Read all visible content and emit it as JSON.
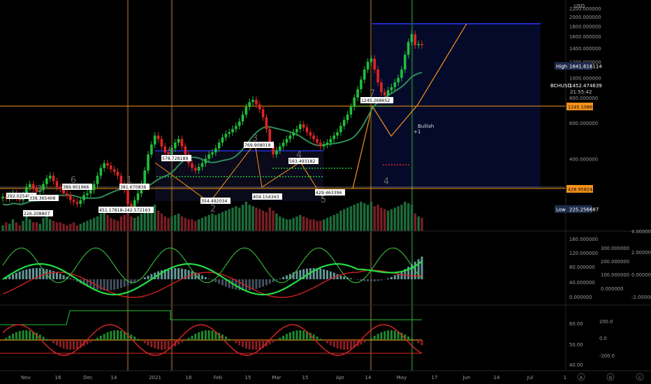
{
  "currency": "USD",
  "symbol_tag": "BCHUSD",
  "last_price": "1452.474639",
  "countdown": "21:55:42",
  "high": {
    "label": "High",
    "value": "1641.616114"
  },
  "low": {
    "label": "Low",
    "value": "225.256687"
  },
  "right_badges": [
    "1245.108652",
    "428.958243"
  ],
  "bullish_label": "Bullish",
  "bullish_count": "+1",
  "wave_labels": [
    "3",
    "6",
    "9",
    "1",
    "2",
    "3",
    "4",
    "5",
    "7",
    "4"
  ],
  "price_pivots": [
    "292.025496",
    "338.365408",
    "389.901966",
    "381.670836",
    "226.208807",
    "451.178184",
    "242.572163",
    "578.728189",
    "354.492034",
    "769.908019",
    "404.154343",
    "593.493182",
    "429.463396",
    "1245.268652"
  ],
  "scales": {
    "main": [
      "2200.000000",
      "2000.000000",
      "1800.000000",
      "1600.000000",
      "1400.000000",
      "1200.000000",
      "1000.000000",
      "800.000000",
      "600.000000",
      "400.000000"
    ],
    "macd_left": [
      "160.000000",
      "120.000000",
      "80.000000",
      "40.000000",
      "0.000000"
    ],
    "macd_mid": [
      "300.000000",
      "200.000000",
      "100.000000",
      "0.000000",
      "-100.000000"
    ],
    "macd_right": [
      "4.000000",
      "2.000000",
      "0.000000",
      "-2.000000"
    ],
    "osc_left": [
      "60.00",
      "50.00",
      "40.00"
    ],
    "osc_right": [
      "200.0",
      "0.0",
      "-200.0"
    ]
  },
  "x_axis": [
    "Nov",
    "16",
    "Dec",
    "14",
    "2021",
    "18",
    "Feb",
    "15",
    "Mar",
    "15",
    "Apr",
    "14",
    "May",
    "17",
    "Jun",
    "14",
    "Jul",
    "1"
  ],
  "corner_buttons": [
    "A",
    "B",
    "C"
  ],
  "chart_data": {
    "type": "candlestick",
    "symbol": "BCHUSD",
    "ylim": [
      225,
      2200
    ],
    "x_range": [
      "Oct 2020",
      "Jul 2021"
    ],
    "closes": [
      260,
      255,
      262,
      270,
      258,
      250,
      265,
      290,
      300,
      285,
      275,
      280,
      300,
      320,
      330,
      310,
      290,
      285,
      270,
      265,
      250,
      245,
      240,
      250,
      265,
      270,
      280,
      300,
      330,
      360,
      380,
      370,
      355,
      345,
      330,
      300,
      280,
      240,
      230,
      250,
      270,
      300,
      350,
      420,
      470,
      520,
      500,
      460,
      430,
      420,
      450,
      480,
      500,
      460,
      420,
      380,
      360,
      350,
      365,
      380,
      400,
      420,
      430,
      450,
      480,
      510,
      530,
      540,
      560,
      580,
      610,
      660,
      720,
      760,
      780,
      740,
      700,
      640,
      560,
      470,
      420,
      440,
      460,
      480,
      500,
      520,
      540,
      560,
      590,
      570,
      540,
      520,
      500,
      480,
      460,
      470,
      480,
      500,
      520,
      540,
      580,
      620,
      660,
      720,
      800,
      880,
      980,
      1100,
      1200,
      1245,
      1100,
      950,
      850,
      820,
      870,
      900,
      950,
      1000,
      1100,
      1300,
      1500,
      1640,
      1450,
      1470,
      1452
    ],
    "volumes": [
      0.2,
      0.3,
      0.25,
      0.4,
      0.3,
      0.2,
      0.35,
      0.5,
      0.4,
      0.3,
      0.3,
      0.25,
      0.45,
      0.5,
      0.4,
      0.35,
      0.3,
      0.3,
      0.25,
      0.2,
      0.25,
      0.3,
      0.2,
      0.25,
      0.3,
      0.35,
      0.4,
      0.45,
      0.5,
      0.6,
      0.7,
      0.55,
      0.45,
      0.4,
      0.35,
      0.5,
      0.55,
      0.6,
      0.5,
      0.45,
      0.5,
      0.6,
      0.7,
      0.75,
      0.8,
      0.9,
      0.7,
      0.6,
      0.5,
      0.45,
      0.5,
      0.55,
      0.6,
      0.5,
      0.45,
      0.4,
      0.4,
      0.35,
      0.4,
      0.45,
      0.5,
      0.55,
      0.6,
      0.55,
      0.6,
      0.65,
      0.7,
      0.75,
      0.8,
      0.85,
      0.8,
      0.9,
      1.0,
      0.9,
      0.85,
      0.8,
      0.75,
      0.7,
      0.65,
      0.8,
      0.7,
      0.6,
      0.5,
      0.45,
      0.4,
      0.4,
      0.45,
      0.5,
      0.55,
      0.5,
      0.45,
      0.4,
      0.4,
      0.35,
      0.35,
      0.4,
      0.45,
      0.5,
      0.55,
      0.6,
      0.7,
      0.75,
      0.8,
      0.85,
      0.9,
      0.95,
      1.0,
      0.95,
      0.9,
      1.0,
      0.85,
      0.9,
      0.8,
      0.75,
      0.7,
      0.75,
      0.8,
      0.85,
      0.9,
      1.0,
      0.95,
      0.9,
      0.6,
      0.5,
      0.45
    ]
  },
  "colors": {
    "up": "#1fbf3a",
    "down": "#e02424",
    "ma": "#2e8b57",
    "orange": "#f7931a",
    "blue": "#2a3bff",
    "grid": "#1a1a1a",
    "panel_line": "#262626"
  }
}
